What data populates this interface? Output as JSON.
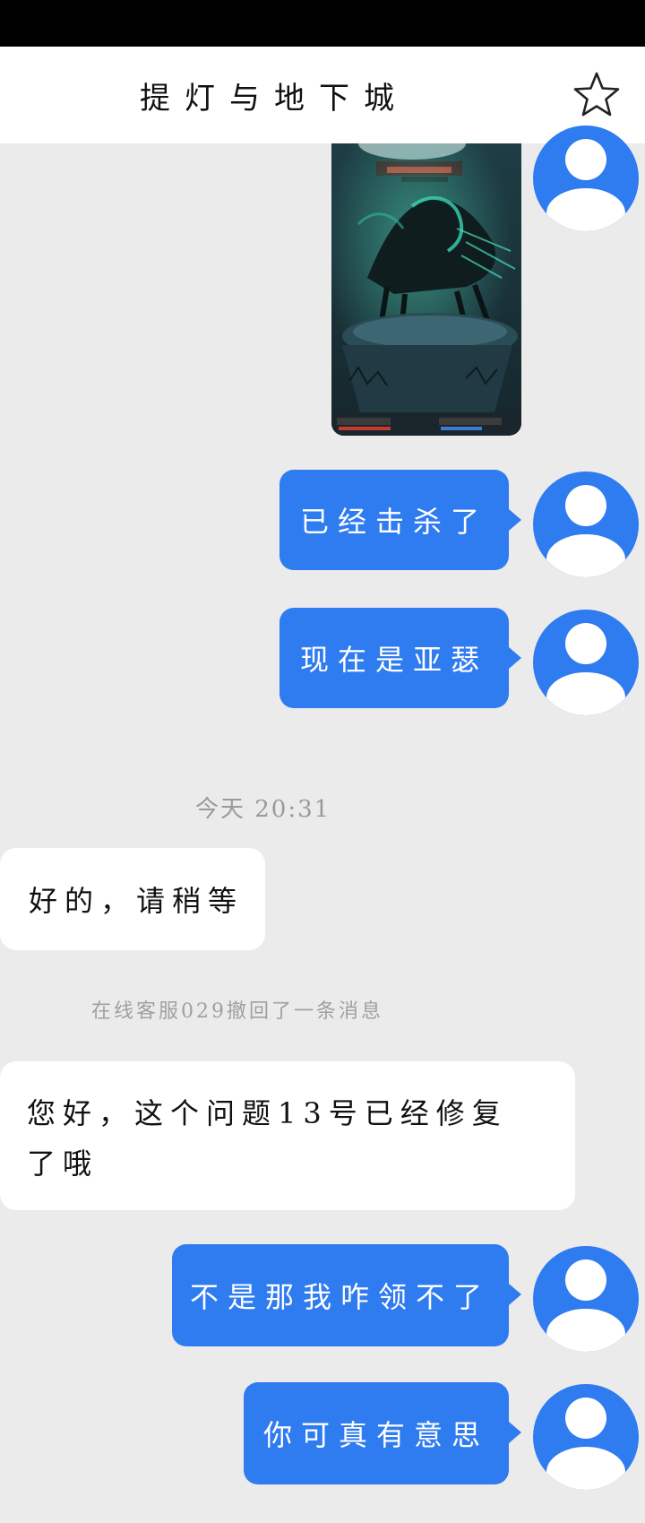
{
  "header": {
    "title": "提灯与地下城",
    "favorite_icon": "star-outline-icon"
  },
  "colors": {
    "accent": "#2f7bf0",
    "background": "#ebebeb",
    "incoming_bubble": "#ffffff",
    "status_bar": "#000000"
  },
  "messages": [
    {
      "id": "m1",
      "from": "user",
      "type": "image",
      "icon": "game-screenshot"
    },
    {
      "id": "m2",
      "from": "user",
      "text": "已经击杀了"
    },
    {
      "id": "m3",
      "from": "user",
      "text": "现在是亚瑟"
    },
    {
      "id": "m4",
      "from": "agent",
      "text": "好的，请稍等"
    },
    {
      "id": "m5",
      "from": "agent",
      "text": "您好，这个问题13号已经修复了哦"
    },
    {
      "id": "m6",
      "from": "user",
      "text": "不是那我咋领不了"
    },
    {
      "id": "m7",
      "from": "user",
      "text": "你可真有意思"
    }
  ],
  "timestamps": {
    "t1": "今天 20:31"
  },
  "system_notes": {
    "recall": "在线客服029撤回了一条消息"
  },
  "avatar_icon": "default-user-avatar-icon"
}
